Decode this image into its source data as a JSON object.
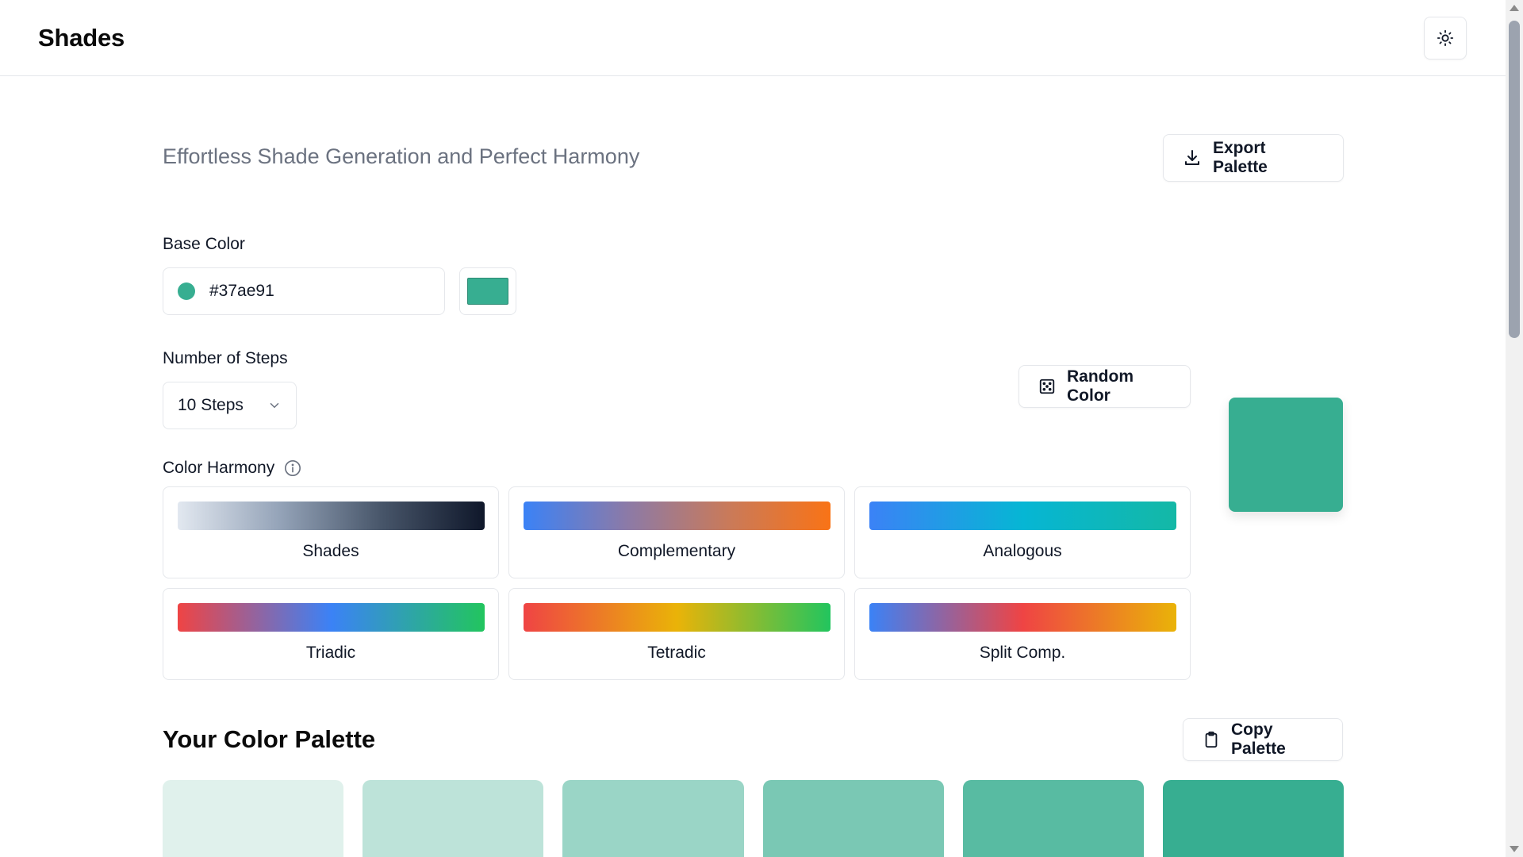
{
  "header": {
    "title": "Shades",
    "theme_icon": "sun-icon"
  },
  "main": {
    "subtitle": "Effortless Shade Generation and Perfect Harmony",
    "export_label": "Export Palette",
    "base_color": {
      "label": "Base Color",
      "value": "#37ae91",
      "color": "#37ae91"
    },
    "steps": {
      "label": "Number of Steps",
      "selected": "10 Steps"
    },
    "random_label": "Random Color",
    "harmony": {
      "label": "Color Harmony",
      "options": [
        {
          "label": "Shades",
          "gradient": [
            "#e2e8f0",
            "#94a3b8",
            "#475569",
            "#0f172a"
          ]
        },
        {
          "label": "Complementary",
          "gradient": [
            "#3b82f6",
            "#8b7aa8",
            "#c97a5a",
            "#f97316"
          ]
        },
        {
          "label": "Analogous",
          "gradient": [
            "#3b82f6",
            "#06b6d4",
            "#14b8a6"
          ]
        },
        {
          "label": "Triadic",
          "gradient": [
            "#ef4444",
            "#3b82f6",
            "#22c55e"
          ]
        },
        {
          "label": "Tetradic",
          "gradient": [
            "#ef4444",
            "#eab308",
            "#22c55e"
          ]
        },
        {
          "label": "Split Comp.",
          "gradient": [
            "#3b82f6",
            "#ef4444",
            "#eab308"
          ]
        }
      ]
    }
  },
  "palette": {
    "title": "Your Color Palette",
    "copy_label": "Copy Palette",
    "swatches": [
      "#e0f1ec",
      "#bde3d9",
      "#9ad5c6",
      "#7ac8b4",
      "#58bba2",
      "#37ae91"
    ]
  }
}
